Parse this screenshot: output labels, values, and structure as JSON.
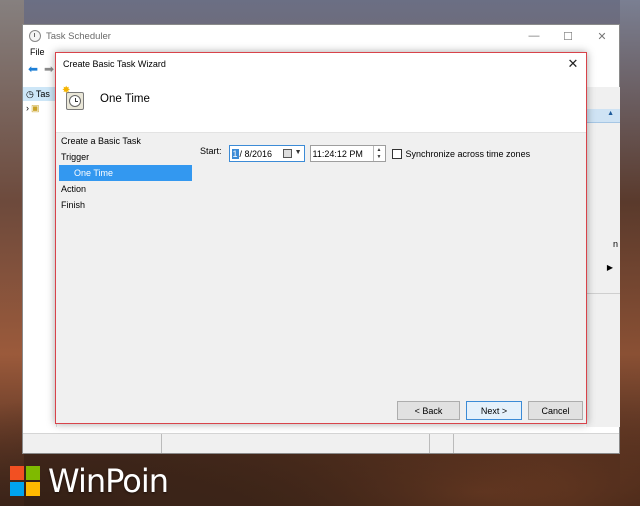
{
  "main_window": {
    "title": "Task Scheduler",
    "menu": [
      "File"
    ],
    "tree_label": "Tas",
    "right_pane_fragment": "n",
    "controls": {
      "minimize": "—",
      "maximize": "☐",
      "close": "✕"
    }
  },
  "wizard": {
    "title": "Create Basic Task Wizard",
    "heading": "One Time",
    "steps": [
      {
        "label": "Create a Basic Task",
        "sub": false,
        "active": false
      },
      {
        "label": "Trigger",
        "sub": false,
        "active": false
      },
      {
        "label": "One Time",
        "sub": true,
        "active": true
      },
      {
        "label": "Action",
        "sub": false,
        "active": false
      },
      {
        "label": "Finish",
        "sub": false,
        "active": false
      }
    ],
    "start_label": "Start:",
    "date": {
      "month": "1",
      "rest": "/  8/2016"
    },
    "time": "11:24:12 PM",
    "sync_label": "Synchronize across time zones",
    "sync_checked": false,
    "buttons": {
      "back": "< Back",
      "next": "Next >",
      "cancel": "Cancel"
    }
  },
  "brand": {
    "logo_text": "WinPoin"
  },
  "colors": {
    "accent": "#3398f0",
    "dialog_border": "#d8434a"
  }
}
